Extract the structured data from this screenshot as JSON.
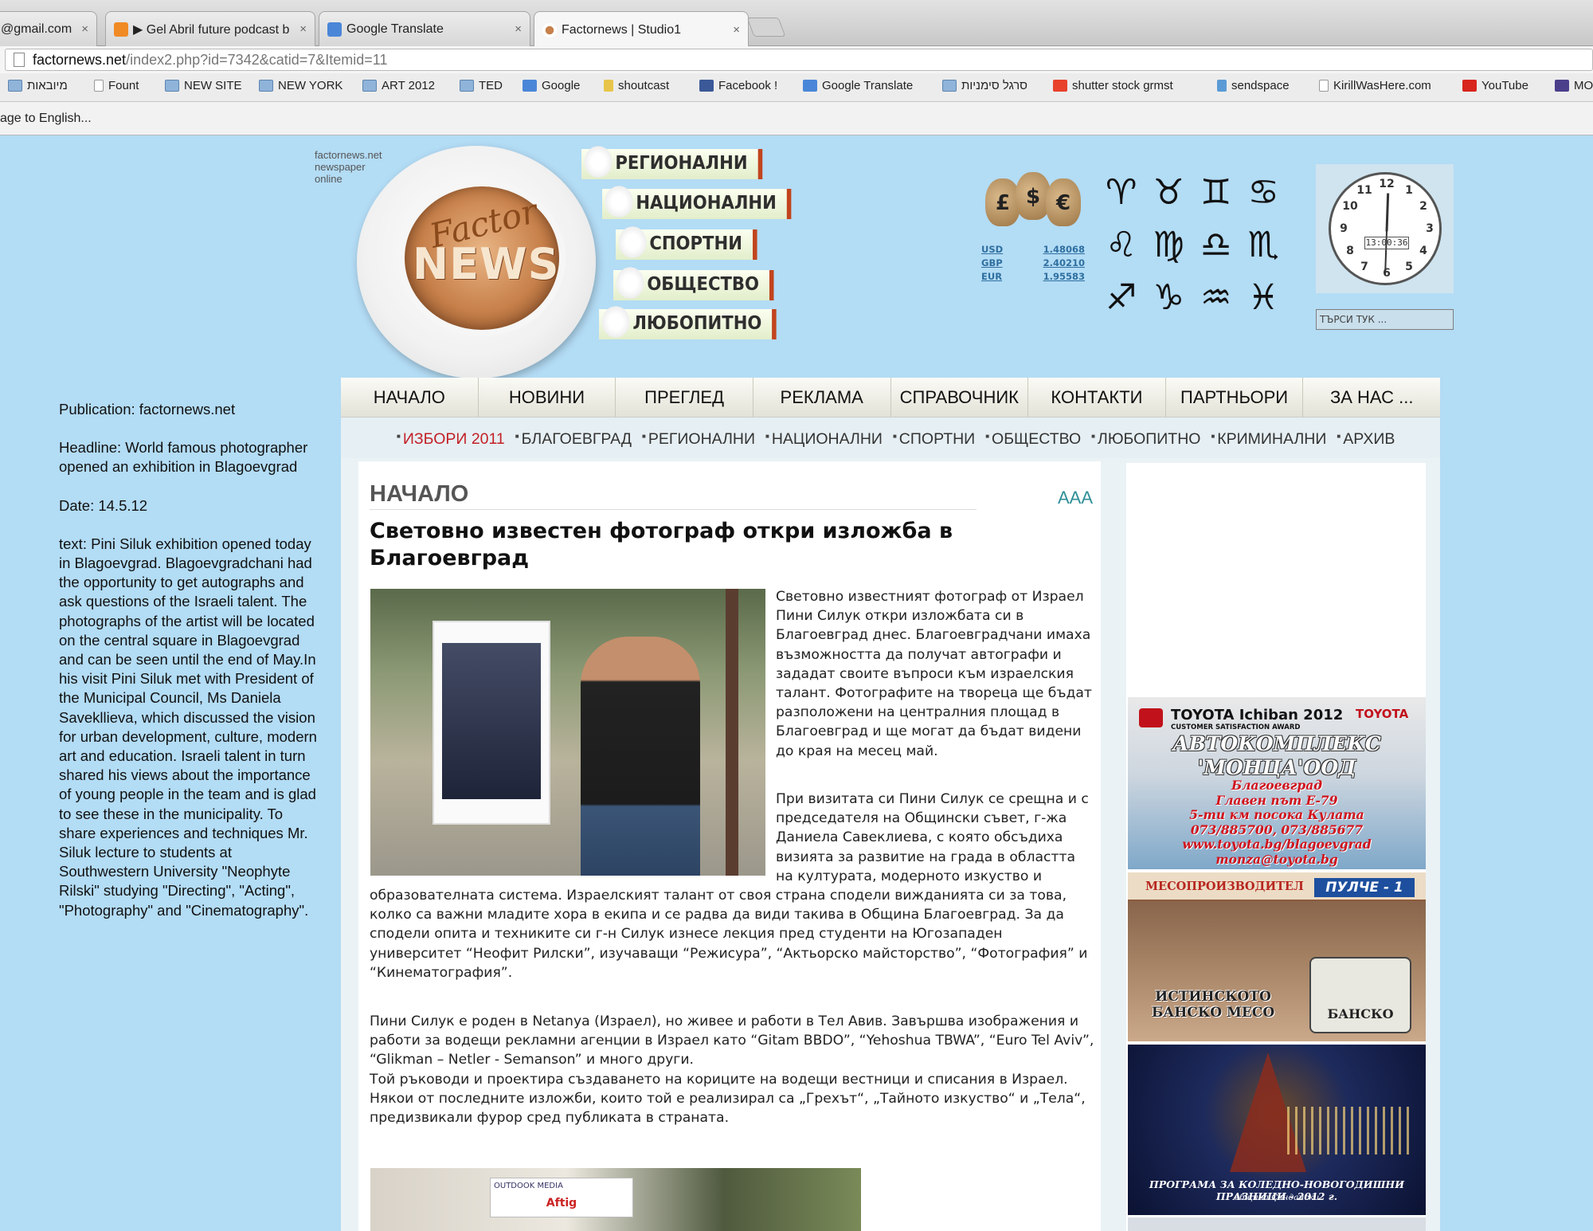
{
  "browser": {
    "tabs": [
      {
        "label": "@gmail.com -",
        "active": false
      },
      {
        "label": "▶ Gel Abril future podcast b",
        "active": false
      },
      {
        "label": "Google Translate",
        "active": false
      },
      {
        "label": "Factornews | Studio1",
        "active": true
      }
    ],
    "tab_close_glyph": "×",
    "url_domain": "factornews.net",
    "url_path": "/index2.php?id=7342&catid=7&Itemid=11",
    "bookmarks": [
      {
        "label": "מיובאות",
        "icon": "folder-icon"
      },
      {
        "label": "Fount",
        "icon": "page-icon"
      },
      {
        "label": "NEW SITE",
        "icon": "folder-icon"
      },
      {
        "label": "NEW YORK",
        "icon": "folder-icon"
      },
      {
        "label": "ART 2012",
        "icon": "folder-icon"
      },
      {
        "label": "TED",
        "icon": "folder-icon"
      },
      {
        "label": "Google",
        "icon": "google-icon"
      },
      {
        "label": "shoutcast",
        "icon": "lightning-icon"
      },
      {
        "label": "Facebook !",
        "icon": "facebook-icon"
      },
      {
        "label": "Google Translate",
        "icon": "translate-icon"
      },
      {
        "label": "סרגל סימניות",
        "icon": "folder-icon"
      },
      {
        "label": "shutter stock grmst",
        "icon": "shutterstock-icon"
      },
      {
        "label": "sendspace",
        "icon": "upload-arrow-icon"
      },
      {
        "label": "KirillWasHere.com",
        "icon": "page-icon"
      },
      {
        "label": "YouTube",
        "icon": "youtube-icon"
      },
      {
        "label": "MO",
        "icon": "bookmark-icon"
      }
    ],
    "translate_bar": "age to English..."
  },
  "notes": {
    "publication": "Publication: factornews.net",
    "headline": "Headline: World famous photographer opened an exhibition in Blagoevgrad",
    "date": "Date: 14.5.12",
    "text": "text: Pini Siluk exhibition opened today in Blagoevgrad. Blagoevgradchani had the opportunity to get autographs and ask questions of the Israeli talent. The photographs of the artist will be located on the central square in Blagoevgrad and can be seen until the end of May.In his visit Pini Siluk met with President of the Municipal Council, Ms Daniela Savekllieva, which discussed the vision for urban development, culture, modern art and education. Israeli talent in turn shared his views about the importance of young people in the team and is glad to see these in the municipality. To share experiences and techniques Mr. Siluk lecture to students at Southwestern University \"Neophyte Rilski\" studying \"Directing\", \"Acting\", \"Photography\" and \"Cinematography\"."
  },
  "site": {
    "mini_brand": [
      "factornews.net",
      "newspaper",
      "online"
    ],
    "logo_top": "Factor",
    "logo_bottom": "NEWS",
    "categories": [
      "РЕГИОНАЛНИ",
      "НАЦИОНАЛНИ",
      "СПОРТНИ",
      "ОБЩЕСТВО",
      "ЛЮБОПИТНО"
    ],
    "money_symbols": [
      "£",
      "$",
      "€"
    ],
    "currency": [
      {
        "code": "USD",
        "rate": "1.48068"
      },
      {
        "code": "GBP",
        "rate": "2.40210"
      },
      {
        "code": "EUR",
        "rate": "1.95583"
      }
    ],
    "zodiac": [
      "♈",
      "♉",
      "♊",
      "♋",
      "♌",
      "♍",
      "♎",
      "♏",
      "♐",
      "♑",
      "♒",
      "♓"
    ],
    "clock_time": "13:00:36",
    "clock_numbers": [
      "12",
      "1",
      "2",
      "3",
      "4",
      "5",
      "6",
      "7",
      "8",
      "9",
      "10",
      "11"
    ],
    "search_placeholder": "ТЪРСИ ТУК ..."
  },
  "nav": {
    "main": [
      "НАЧАЛО",
      "НОВИНИ",
      "ПРЕГЛЕД",
      "РЕКЛАМА",
      "СПРАВОЧНИК",
      "КОНТАКТИ",
      "ПАРТНЬОРИ",
      "ЗА НАС ..."
    ],
    "sub": [
      "ИЗБОРИ 2011",
      "БЛАГОЕВГРАД",
      "РЕГИОНАЛНИ",
      "НАЦИОНАЛНИ",
      "СПОРТНИ",
      "ОБЩЕСТВО",
      "ЛЮБОПИТНО",
      "КРИМИНАЛНИ",
      "АРХИВ"
    ]
  },
  "article": {
    "section": "НАЧАЛО",
    "font_size_control": "AAA",
    "headline": "Световно известен фотограф откри изложба в Благоевград",
    "para1": "Световно известният фотограф от Израел Пини Силук откри изложбата си в Благоевград днес. Благоевградчани имаха възможността да получат автографи и зададат своите въпроси към израелския талант. Фотографите на твореца ще бъдат разположени на централния площад в Благоевград и ще могат да бъдат видени до края на месец май.",
    "para2a": "При визитата си Пини Силук се срещна и с председателя на Общински съвет, г-жа Даниела Савеклиева, с която обсъдиха визията за развитие на града в областта на културата, модерното изкуство и",
    "para2b": "образователната система. Израелският талант от своя страна сподели вижданията си за това, колко са важни младите хора в екипа и се радва да види такива в Община Благоевград. За да сподели опита и техниките си г-н Силук изнесе лекция пред студенти на Югозападен университет “Неофит Рилски”, изучаващи “Режисура”, “Актьорско майсторство”, “Фотография” и “Кинематография”.",
    "para3": "Пини Силук е роден в Netanya (Израел), но живее и работи в Тел Авив. Завършва изображения и работи за водещи рекламни агенции в Израел като “Gitam BBDO”, “Yehoshua TBWA”, “Euro Tel Aviv”, “Glikman – Netler - Semanson” и много други.\nТой ръководи и проектира създаването на кориците на водещи вестници и списания в Израел. Някои от последните изложби, които той е реализирал са „Грехът“, „Тайното изкуство“ и „Тела“, предизвикали фурор сред публиката в страната.",
    "photo2_sign": "OUTDOOK MEDIA",
    "photo2_sign_red": "Aftig"
  },
  "ads": {
    "toyota": {
      "head": "TOYOTA Ichiban 2012",
      "sub": "CUSTOMER SATISFACTION AWARD",
      "brand": "TOYOTA",
      "title": "АВТОКОМПЛЕКС 'МОНЦА'ООД",
      "lines": [
        "Благоевград",
        "Главен път Е-79",
        "5-ти км посока Кулата",
        "073/885700, 073/885677",
        "www.toyota.bg/blagoevgrad",
        "monza@toyota.bg"
      ]
    },
    "meat": {
      "label": "МЕСОПРОИЗВОДИТЕЛ",
      "brand": "ПУЛЧЕ - 1",
      "body": "ИСТИНСКОТО БАНСКО МЕСО",
      "logo": "БАНСКО"
    },
    "xmas": {
      "title": "ПРОГРАМА ЗА КОЛЕДНО-НОВОГОДИШНИ ПРАЗНИЦИ - 2012 г.",
      "sub": "община Сандански"
    }
  }
}
